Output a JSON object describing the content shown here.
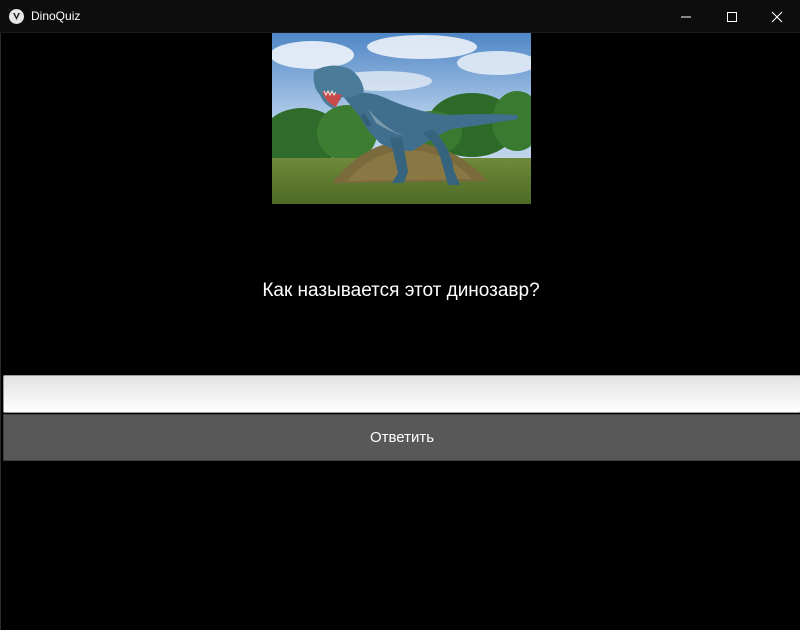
{
  "window": {
    "title": "DinoQuiz",
    "icon": "kivy-app-icon",
    "controls": {
      "minimize_icon": "minimize-icon",
      "maximize_icon": "maximize-icon",
      "close_icon": "close-icon"
    }
  },
  "quiz": {
    "image": {
      "subject": "tyrannosaurus-statue",
      "icon": "dinosaur-photo"
    },
    "question": "Как называется этот динозавр?",
    "answer": {
      "value": "",
      "placeholder": ""
    },
    "submit_label": "Ответить"
  },
  "colors": {
    "background": "#000000",
    "titlebar": "#0d0d0d",
    "button": "#585858",
    "text": "#ffffff"
  }
}
